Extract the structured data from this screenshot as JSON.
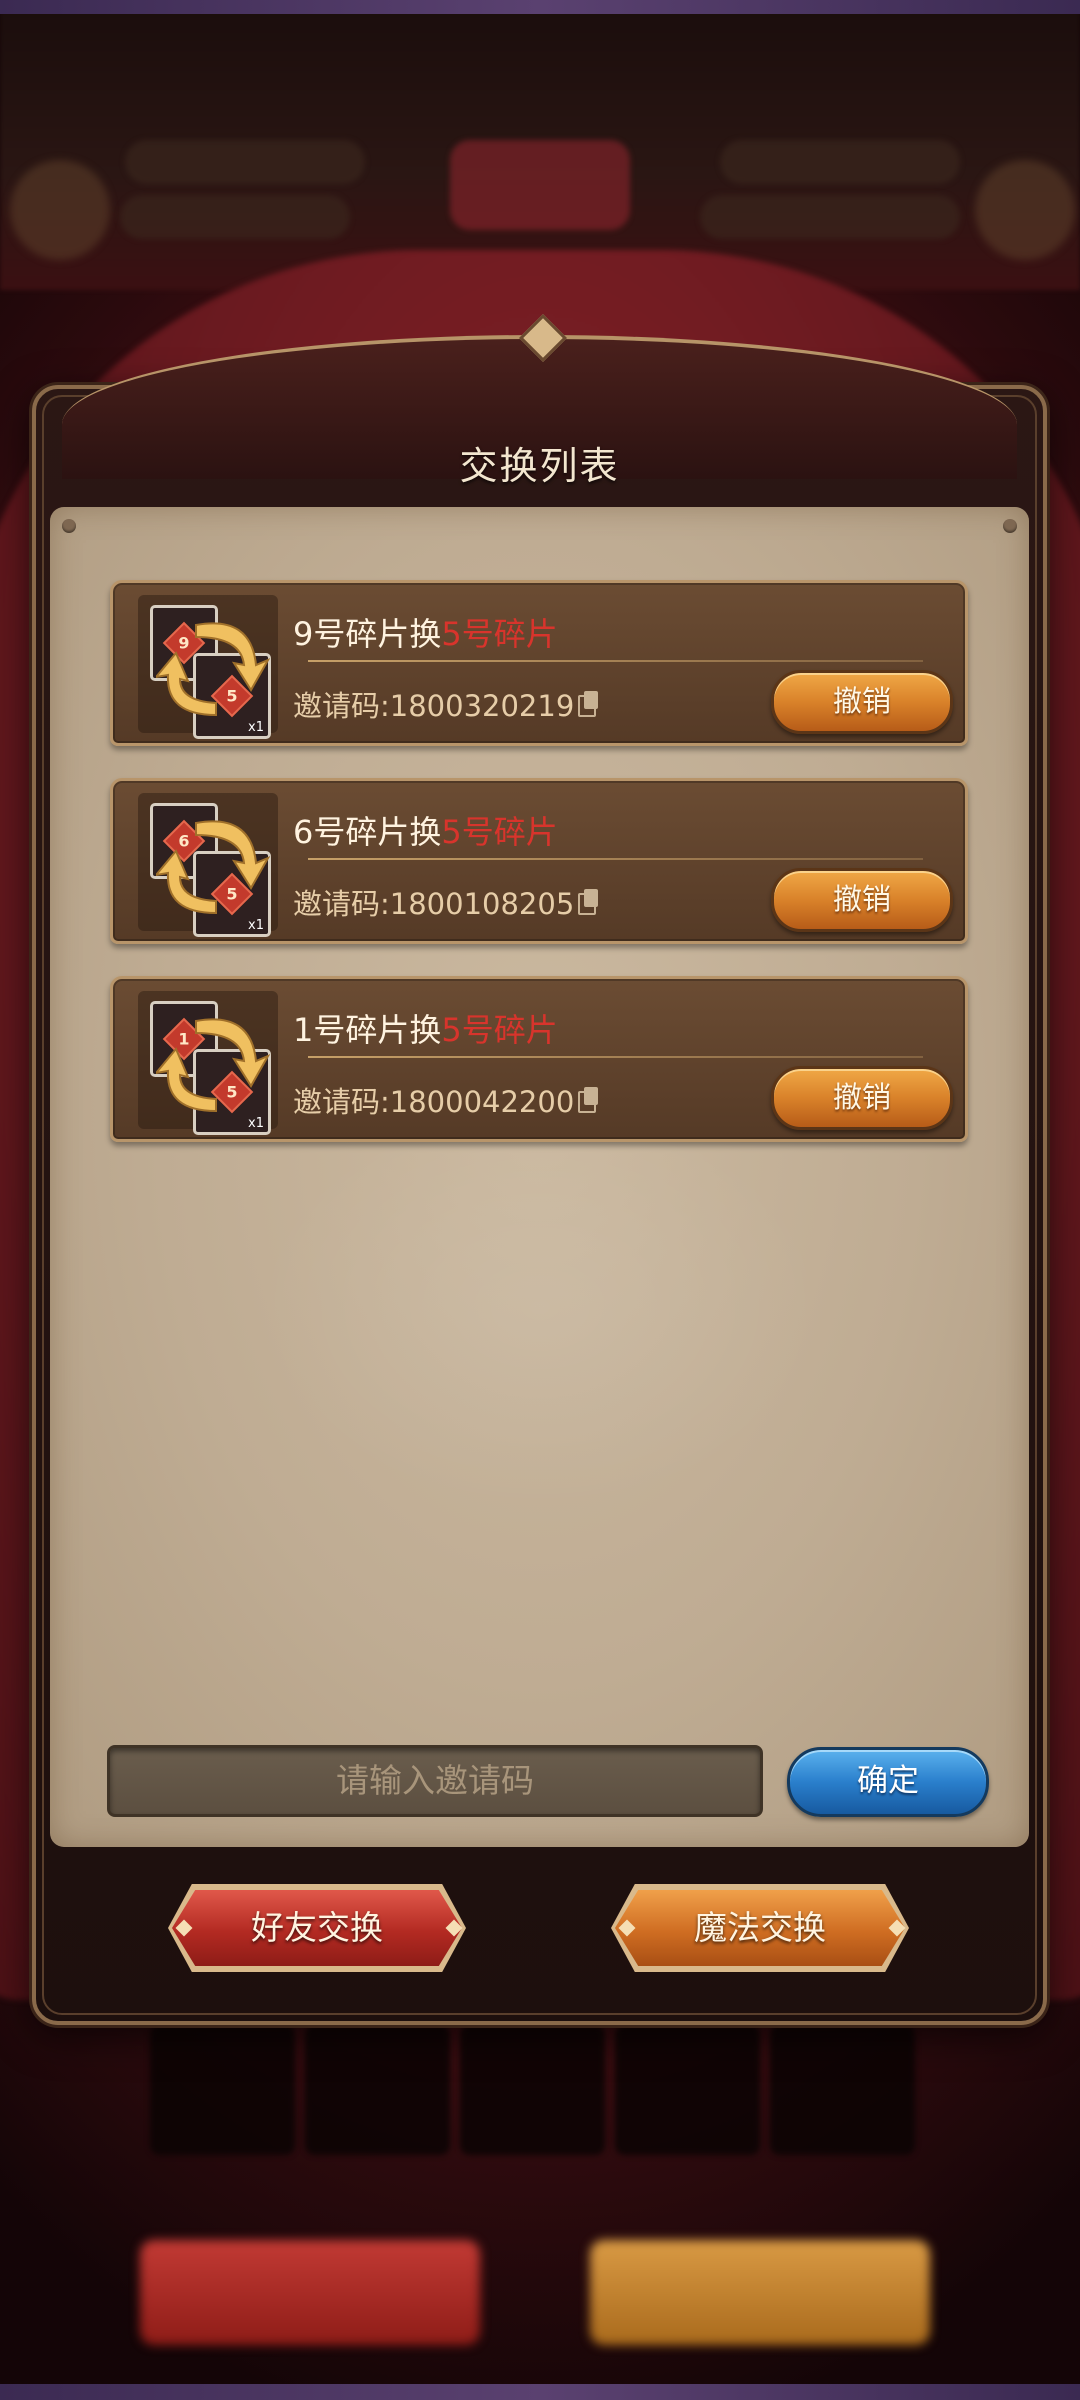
{
  "dialog": {
    "title": "交换列表"
  },
  "exchanges": [
    {
      "offer_card": "9",
      "want_card": "5",
      "quantity": "x1",
      "title_prefix": "9号碎片换",
      "title_highlight": "5号碎片",
      "invite_label": "邀请码:1800320219",
      "cancel_label": "撤销"
    },
    {
      "offer_card": "6",
      "want_card": "5",
      "quantity": "x1",
      "title_prefix": "6号碎片换",
      "title_highlight": "5号碎片",
      "invite_label": "邀请码:1800108205",
      "cancel_label": "撤销"
    },
    {
      "offer_card": "1",
      "want_card": "5",
      "quantity": "x1",
      "title_prefix": "1号碎片换",
      "title_highlight": "5号碎片",
      "invite_label": "邀请码:1800042200",
      "cancel_label": "撤销"
    }
  ],
  "invite_input": {
    "value": "",
    "placeholder": "请输入邀请码"
  },
  "confirm_label": "确定",
  "bottom_buttons": {
    "friend_exchange": "好友交换",
    "magic_exchange": "魔法交换"
  },
  "icons": {
    "copy": "copy-icon",
    "swap": "swap-arrows-icon"
  },
  "colors": {
    "highlight_red": "#d8342c",
    "cancel_orange": "#d9822a",
    "confirm_blue": "#2a7fcc",
    "friend_red": "#b32a22",
    "magic_orange": "#cf6d22"
  }
}
